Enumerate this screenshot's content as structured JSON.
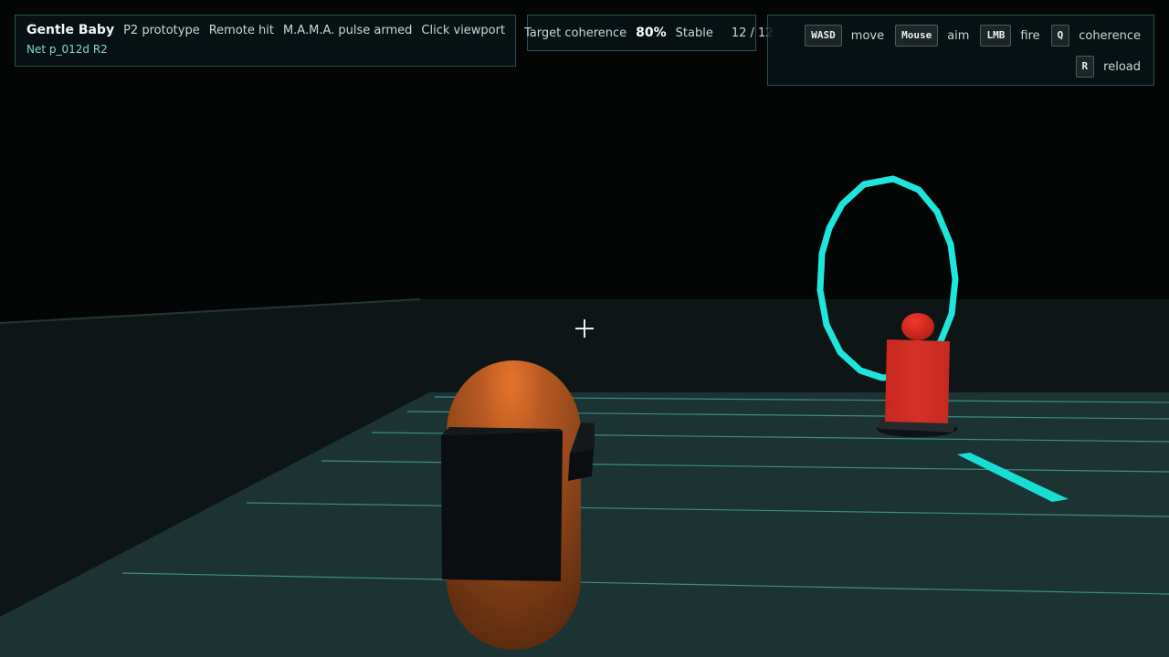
{
  "hud": {
    "title": "Gentle Baby",
    "tags": [
      "P2 prototype",
      "Remote hit",
      "M.A.M.A. pulse armed",
      "Click viewport"
    ],
    "net": "Net p_012d R2"
  },
  "coherence": {
    "label": "Target coherence",
    "percent": "80%",
    "state": "Stable",
    "ammo": "12 / 12"
  },
  "controls": {
    "row1": [
      {
        "key": "WASD",
        "action": "move"
      },
      {
        "key": "Mouse",
        "action": "aim"
      },
      {
        "key": "LMB",
        "action": "fire"
      },
      {
        "key": "Q",
        "action": "coherence"
      }
    ],
    "row2": [
      {
        "key": "R",
        "action": "reload"
      }
    ]
  },
  "colors": {
    "sky": "#040606",
    "floor": "#1b3434",
    "wall": "#0d1515",
    "grid_line": "#4fa7a0",
    "ring": "#1ee6dd",
    "player": "#b55a22",
    "target": "#d2342a"
  }
}
